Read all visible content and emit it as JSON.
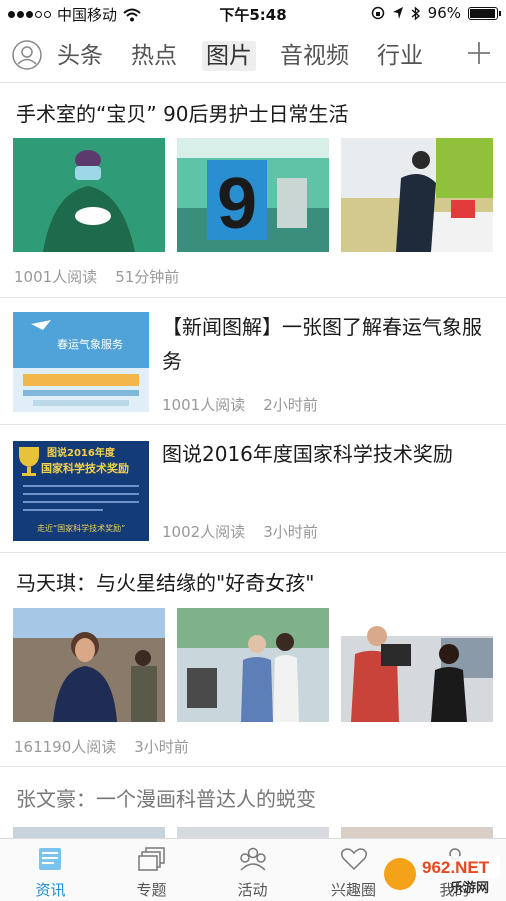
{
  "status_bar": {
    "carrier": "中国移动",
    "time": "下午5:48",
    "battery": "96%",
    "battery_level": 0.96
  },
  "tabs": [
    {
      "label": "头条"
    },
    {
      "label": "热点"
    },
    {
      "label": "图片",
      "active": true
    },
    {
      "label": "音视频"
    },
    {
      "label": "行业"
    }
  ],
  "feed": [
    {
      "title": "手术室的“宝贝” 90后男护士日常生活",
      "reads": "1001人阅读",
      "time": "51分钟前"
    },
    {
      "title": "【新闻图解】一张图了解春运气象服务",
      "reads": "1001人阅读",
      "time": "2小时前",
      "thumb_text": "春运气象服务"
    },
    {
      "title": "图说2016年度国家科学技术奖励",
      "reads": "1002人阅读",
      "time": "3小时前",
      "thumb_text_1": "图说2016年度",
      "thumb_text_2": "国家科学技术奖励",
      "thumb_text_3": "走近“国家科学技术奖励”"
    },
    {
      "title": "马天琪：与火星结缘的\"好奇女孩\"",
      "reads": "161190人阅读",
      "time": "3小时前"
    },
    {
      "title": "张文豪：一个漫画科普达人的蜕变"
    }
  ],
  "bottom_nav": [
    {
      "label": "资讯",
      "icon": "news-icon",
      "active": true
    },
    {
      "label": "专题",
      "icon": "topics-icon"
    },
    {
      "label": "活动",
      "icon": "activity-icon"
    },
    {
      "label": "兴趣圈",
      "icon": "heart-icon"
    },
    {
      "label": "我的",
      "icon": "profile-icon"
    }
  ],
  "watermark": {
    "brand": "962.NET",
    "sub": "乐游网"
  },
  "colors": {
    "accent": "#1a8fd6",
    "text": "#1a1a1a",
    "meta": "#999999"
  }
}
